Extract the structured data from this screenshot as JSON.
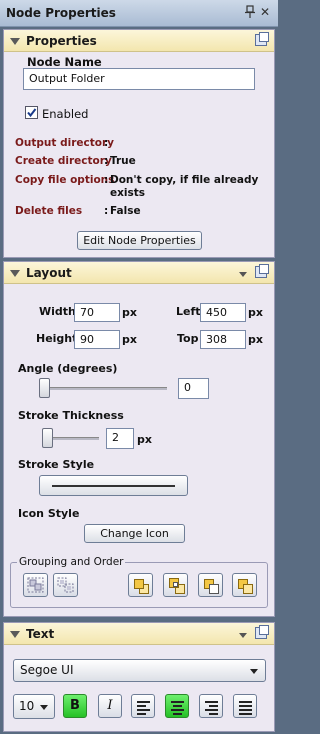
{
  "window": {
    "title": "Node Properties",
    "close_glyph": "✕"
  },
  "properties": {
    "header": "Properties",
    "node_name_label": "Node Name",
    "node_name_value": "Output Folder",
    "enabled_label": "Enabled",
    "enabled_checked": true,
    "rows": [
      {
        "key": "Output directory",
        "sep": ":",
        "value": ""
      },
      {
        "key": "Create directory",
        "sep": ":",
        "value": "True"
      },
      {
        "key": "Copy file options",
        "sep": ":",
        "value": "Don't copy, if file already exists"
      },
      {
        "key": "Delete files",
        "sep": ":",
        "value": "False"
      }
    ],
    "edit_button": "Edit Node Properties"
  },
  "layout": {
    "header": "Layout",
    "width_label": "Width",
    "width_value": "70",
    "height_label": "Height",
    "height_value": "90",
    "left_label": "Left",
    "left_value": "450",
    "top_label": "Top",
    "top_value": "308",
    "unit": "px",
    "angle_label": "Angle (degrees)",
    "angle_value": "0",
    "stroke_thickness_label": "Stroke Thickness",
    "stroke_thickness_value": "2",
    "stroke_style_label": "Stroke Style",
    "icon_style_label": "Icon Style",
    "change_icon_button": "Change Icon",
    "grouping_label": "Grouping and Order"
  },
  "text": {
    "header": "Text",
    "font_family": "Segoe UI",
    "font_size": "10",
    "bold_label": "B",
    "italic_label": "I",
    "bold_active": true,
    "active_alignment": "center"
  },
  "colors": {
    "section_header": "#f3e6ae",
    "panel_bg": "#ece8f2",
    "prop_key": "#7a1a1a",
    "active_toggle": "#26c126"
  },
  "icons": [
    "pin-icon",
    "close-icon",
    "collapse-triangle-icon",
    "popout-icon",
    "dropdown-arrow-icon",
    "group-icon",
    "ungroup-icon",
    "bring-to-front-icon",
    "bring-forward-icon",
    "send-backward-icon",
    "send-to-back-icon",
    "align-left-icon",
    "align-center-icon",
    "align-right-icon",
    "justify-icon"
  ]
}
